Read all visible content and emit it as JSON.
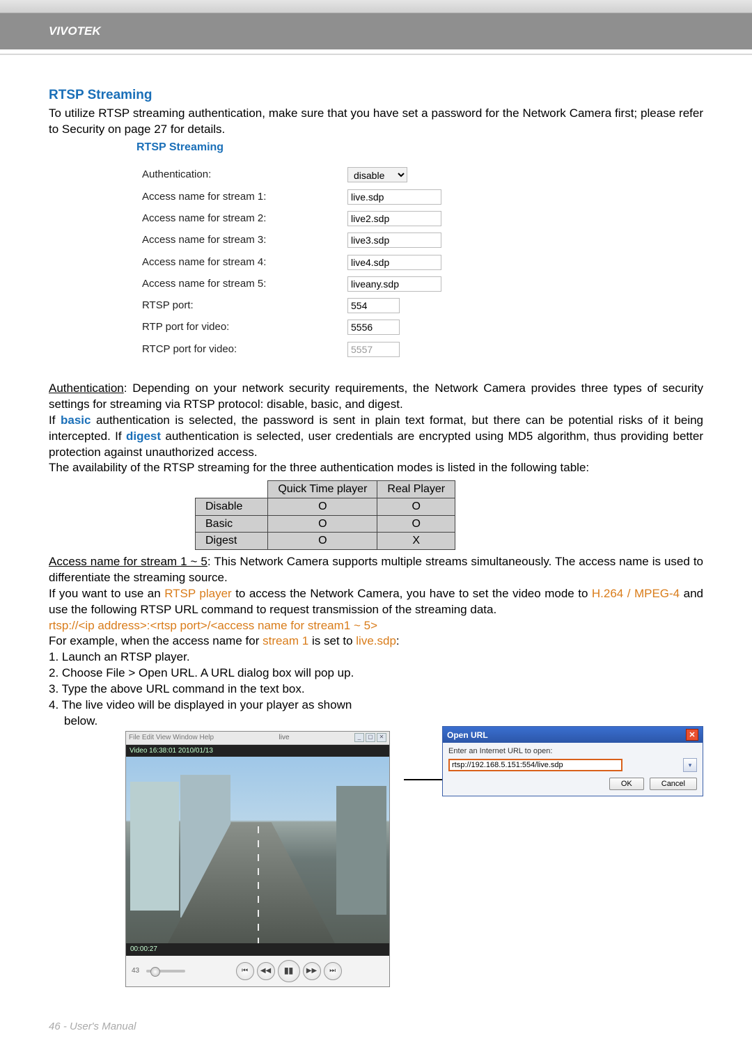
{
  "header": {
    "brand": "VIVOTEK"
  },
  "section": {
    "title": "RTSP Streaming",
    "intro": "To utilize RTSP streaming authentication, make sure that you have set a password for the Network Camera first; please refer to Security on page 27 for details."
  },
  "form": {
    "legend": "RTSP Streaming",
    "auth_label": "Authentication:",
    "auth_value": "disable",
    "s1_label": "Access name for stream 1:",
    "s1_value": "live.sdp",
    "s2_label": "Access name for stream 2:",
    "s2_value": "live2.sdp",
    "s3_label": "Access name for stream 3:",
    "s3_value": "live3.sdp",
    "s4_label": "Access name for stream 4:",
    "s4_value": "live4.sdp",
    "s5_label": "Access name for stream 5:",
    "s5_value": "liveany.sdp",
    "rtsp_port_label": "RTSP port:",
    "rtsp_port_value": "554",
    "rtp_port_label": "RTP port for video:",
    "rtp_port_value": "5556",
    "rtcp_port_label": "RTCP port for video:",
    "rtcp_port_value": "5557"
  },
  "auth_para": {
    "lead": "Authentication",
    "p1": ": Depending on your network security requirements, the Network Camera provides three types of security settings for streaming via RTSP protocol: disable, basic, and digest.",
    "p2a": "If ",
    "p2b": "basic",
    "p2c": " authentication is selected, the password is sent in plain text format, but there can be potential risks of it being intercepted. If ",
    "p2d": "digest",
    "p2e": " authentication is selected, user credentials are encrypted using MD5 algorithm, thus providing better protection against unauthorized access.",
    "p3": "The availability of the RTSP streaming for the three authentication modes is listed in the following table:"
  },
  "table": {
    "h1": "Quick Time player",
    "h2": "Real Player",
    "r1": "Disable",
    "r1c1": "O",
    "r1c2": "O",
    "r2": "Basic",
    "r2c1": "O",
    "r2c2": "O",
    "r3": "Digest",
    "r3c1": "O",
    "r3c2": "X"
  },
  "access": {
    "lead": "Access name for stream 1 ~ 5",
    "p1": ": This Network Camera supports multiple streams simultaneously. The access name is used to differentiate the streaming source.",
    "p2a": "If you want to use an ",
    "p2b": "RTSP player",
    "p2c": " to access the Network Camera, you have to set the video mode to ",
    "p2d": "H.264 / MPEG-4",
    "p2e": " and use the following RTSP URL command to request transmission of the streaming data.",
    "url_tpl": "rtsp://<ip address>:<rtsp port>/<access name for stream1 ~ 5>",
    "ex_a": "For example, when the access name for ",
    "ex_b": "stream 1",
    "ex_c": " is set to ",
    "ex_d": "live.sdp",
    "ex_e": ":",
    "s1": "1. Launch an RTSP player.",
    "s2": "2. Choose File > Open URL. A URL dialog box will pop up.",
    "s3": "3. Type the above URL command in the text box.",
    "s4": "4. The live video will be displayed in your player as shown",
    "s4b": "below."
  },
  "dialog": {
    "title": "Open URL",
    "prompt": "Enter an Internet URL to open:",
    "url": "rtsp://192.168.5.151:554/live.sdp",
    "ok": "OK",
    "cancel": "Cancel"
  },
  "player": {
    "title_left": "File Edit View Window Help",
    "title_center": "live",
    "overlay": "Video 16:38:01 2010/01/13",
    "time": "00:00:27",
    "vol": "43"
  },
  "footer": {
    "text": "46 - User's Manual"
  }
}
